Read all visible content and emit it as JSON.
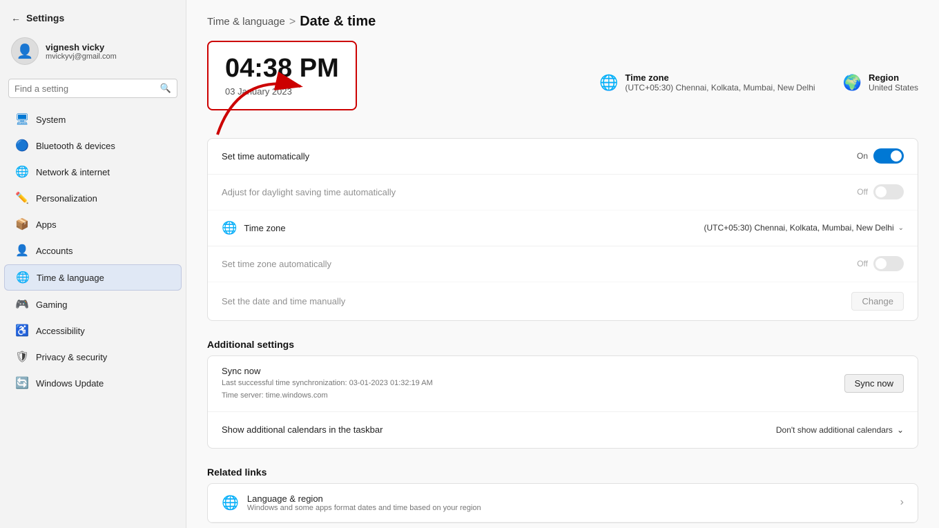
{
  "window": {
    "title": "Settings"
  },
  "sidebar": {
    "back_label": "←",
    "title": "Settings",
    "user": {
      "name": "vignesh vicky",
      "email": "mvickyvj@gmail.com"
    },
    "search_placeholder": "Find a setting",
    "items": [
      {
        "id": "system",
        "label": "System",
        "icon": "🖥",
        "color": "blue",
        "active": false
      },
      {
        "id": "bluetooth",
        "label": "Bluetooth & devices",
        "icon": "🔵",
        "color": "teal",
        "active": false
      },
      {
        "id": "network",
        "label": "Network & internet",
        "icon": "🌐",
        "color": "blue",
        "active": false
      },
      {
        "id": "personalization",
        "label": "Personalization",
        "icon": "✏️",
        "color": "orange",
        "active": false
      },
      {
        "id": "apps",
        "label": "Apps",
        "icon": "📦",
        "color": "orange",
        "active": false
      },
      {
        "id": "accounts",
        "label": "Accounts",
        "icon": "👤",
        "color": "green",
        "active": false
      },
      {
        "id": "time",
        "label": "Time & language",
        "icon": "🌐",
        "color": "blue",
        "active": true
      },
      {
        "id": "gaming",
        "label": "Gaming",
        "icon": "🎮",
        "color": "dark",
        "active": false
      },
      {
        "id": "accessibility",
        "label": "Accessibility",
        "icon": "♿",
        "color": "darkblue",
        "active": false
      },
      {
        "id": "privacy",
        "label": "Privacy & security",
        "icon": "🛡",
        "color": "dark",
        "active": false
      },
      {
        "id": "update",
        "label": "Windows Update",
        "icon": "🔄",
        "color": "blue",
        "active": false
      }
    ]
  },
  "breadcrumb": {
    "parent": "Time & language",
    "separator": ">",
    "current": "Date & time"
  },
  "clock": {
    "time": "04:38 PM",
    "date": "03 January 2023"
  },
  "timezone_info": {
    "label": "Time zone",
    "value": "(UTC+05:30) Chennai, Kolkata, Mumbai, New Delhi"
  },
  "region_info": {
    "label": "Region",
    "value": "United States"
  },
  "settings": [
    {
      "id": "set-time-auto",
      "label": "Set time automatically",
      "control": "toggle",
      "state": "on",
      "toggle_text": "On",
      "disabled": false
    },
    {
      "id": "daylight-saving",
      "label": "Adjust for daylight saving time automatically",
      "control": "toggle",
      "state": "off",
      "toggle_text": "Off",
      "disabled": true
    },
    {
      "id": "timezone",
      "label": "Time zone",
      "control": "dropdown",
      "value": "(UTC+05:30) Chennai, Kolkata, Mumbai, New Delhi",
      "disabled": false
    },
    {
      "id": "set-tz-auto",
      "label": "Set time zone automatically",
      "control": "toggle",
      "state": "off",
      "toggle_text": "Off",
      "disabled": true
    },
    {
      "id": "set-date-manual",
      "label": "Set the date and time manually",
      "control": "button",
      "button_label": "Change",
      "disabled": true
    }
  ],
  "additional_settings": {
    "title": "Additional settings",
    "sync": {
      "title": "Sync now",
      "last_sync": "Last successful time synchronization: 03-01-2023 01:32:19 AM",
      "server": "Time server: time.windows.com",
      "button_label": "Sync now"
    },
    "calendars": {
      "label": "Show additional calendars in the taskbar",
      "value": "Don't show additional calendars",
      "chevron": "⌄"
    }
  },
  "related_links": {
    "title": "Related links",
    "items": [
      {
        "id": "language-region",
        "icon": "🌐",
        "label": "Language & region",
        "description": "Windows and some apps format dates and time based on your region"
      }
    ]
  }
}
